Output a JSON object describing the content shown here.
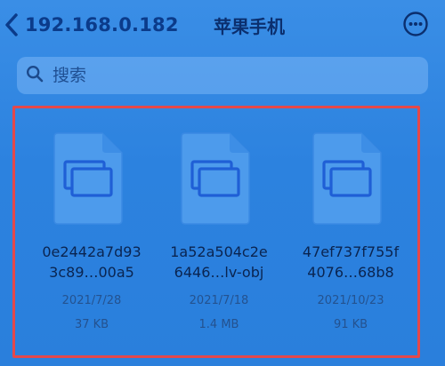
{
  "header": {
    "back_label": "192.168.0.182",
    "title": "苹果手机"
  },
  "search": {
    "placeholder": "搜索",
    "value": ""
  },
  "files": [
    {
      "name_line1": "0e2442a7d93",
      "name_line2": "3c89…00a5",
      "date": "2021/7/28",
      "size": "37 KB"
    },
    {
      "name_line1": "1a52a504c2e",
      "name_line2": "6446…lv-obj",
      "date": "2021/7/18",
      "size": "1.4 MB"
    },
    {
      "name_line1": "47ef737f755f",
      "name_line2": "4076…68b8",
      "date": "2021/10/23",
      "size": "91 KB"
    }
  ],
  "colors": {
    "background": "#2f86e3",
    "highlight_border": "#e4484a",
    "icon_stroke": "#1f5fd6"
  },
  "icons": {
    "back": "chevron-left-icon",
    "more": "ellipsis-circle-icon",
    "search": "magnifier-icon",
    "file": "document-icon"
  }
}
